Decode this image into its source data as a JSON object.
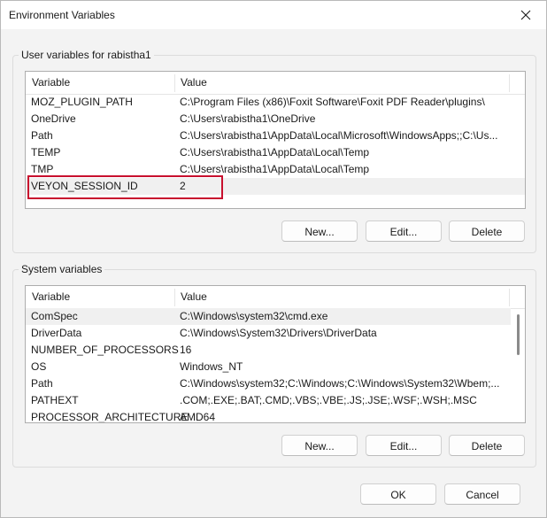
{
  "window": {
    "title": "Environment Variables"
  },
  "user_vars": {
    "group_label": "User variables for rabistha1",
    "columns": [
      "Variable",
      "Value"
    ],
    "rows": [
      {
        "variable": "MOZ_PLUGIN_PATH",
        "value": "C:\\Program Files (x86)\\Foxit Software\\Foxit PDF Reader\\plugins\\"
      },
      {
        "variable": "OneDrive",
        "value": "C:\\Users\\rabistha1\\OneDrive"
      },
      {
        "variable": "Path",
        "value": "C:\\Users\\rabistha1\\AppData\\Local\\Microsoft\\WindowsApps;;C:\\Us..."
      },
      {
        "variable": "TEMP",
        "value": "C:\\Users\\rabistha1\\AppData\\Local\\Temp"
      },
      {
        "variable": "TMP",
        "value": "C:\\Users\\rabistha1\\AppData\\Local\\Temp"
      },
      {
        "variable": "VEYON_SESSION_ID",
        "value": "2"
      }
    ],
    "selected_index": 5,
    "buttons": {
      "new": "New...",
      "edit": "Edit...",
      "delete": "Delete"
    }
  },
  "system_vars": {
    "group_label": "System variables",
    "columns": [
      "Variable",
      "Value"
    ],
    "rows": [
      {
        "variable": "ComSpec",
        "value": "C:\\Windows\\system32\\cmd.exe"
      },
      {
        "variable": "DriverData",
        "value": "C:\\Windows\\System32\\Drivers\\DriverData"
      },
      {
        "variable": "NUMBER_OF_PROCESSORS",
        "value": "16"
      },
      {
        "variable": "OS",
        "value": "Windows_NT"
      },
      {
        "variable": "Path",
        "value": "C:\\Windows\\system32;C:\\Windows;C:\\Windows\\System32\\Wbem;..."
      },
      {
        "variable": "PATHEXT",
        "value": ".COM;.EXE;.BAT;.CMD;.VBS;.VBE;.JS;.JSE;.WSF;.WSH;.MSC"
      },
      {
        "variable": "PROCESSOR_ARCHITECTURE",
        "value": "AMD64"
      }
    ],
    "selected_index": 0,
    "buttons": {
      "new": "New...",
      "edit": "Edit...",
      "delete": "Delete"
    }
  },
  "footer": {
    "ok": "OK",
    "cancel": "Cancel"
  },
  "colors": {
    "highlight_box": "#c8102e"
  },
  "icons": {
    "close": "close-icon"
  }
}
